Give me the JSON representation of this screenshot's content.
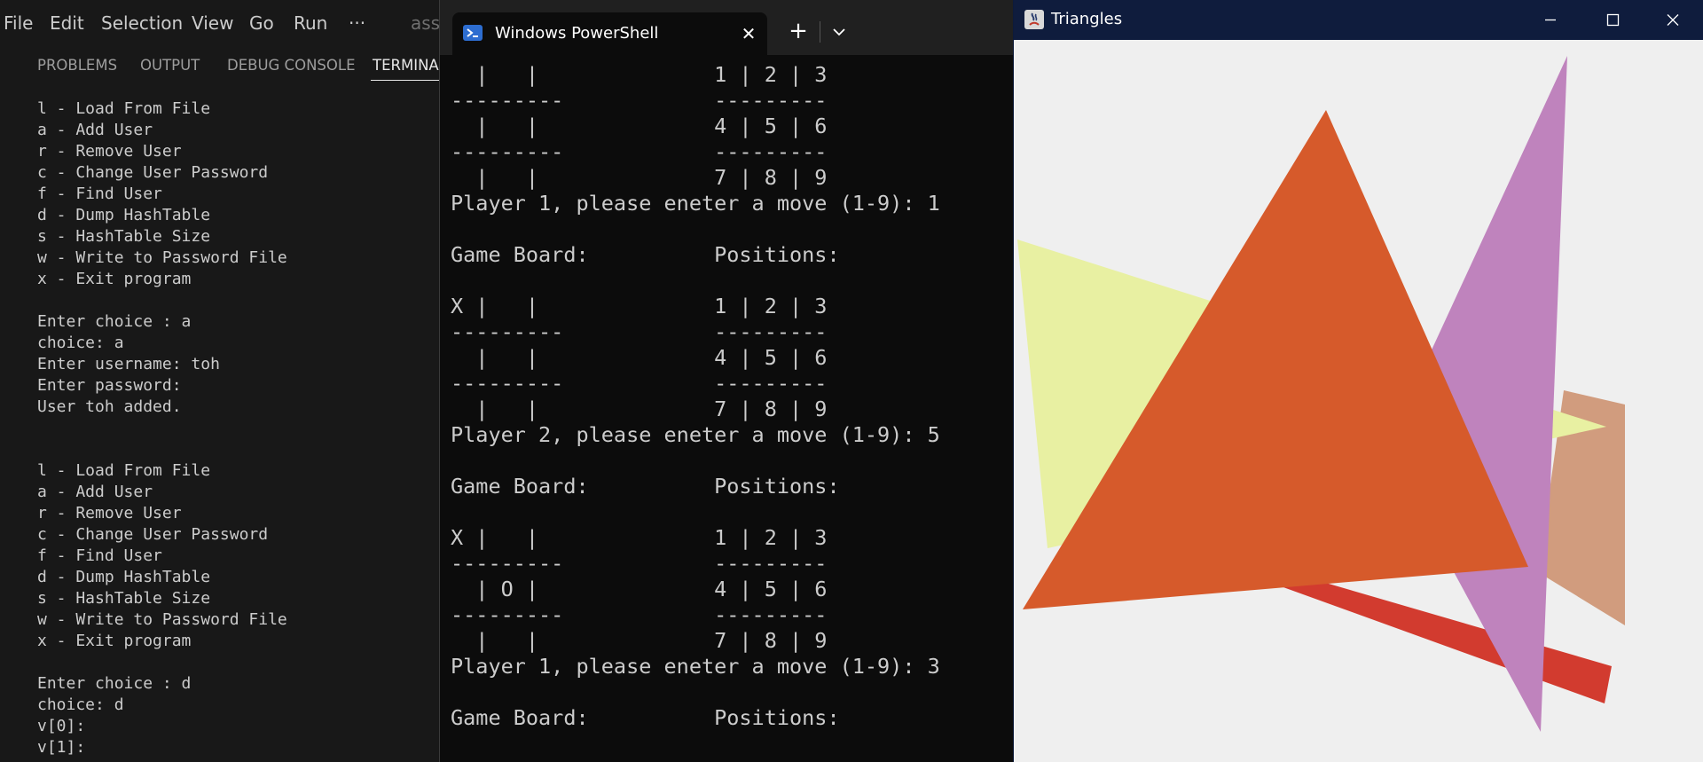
{
  "vscode": {
    "menu": [
      {
        "label": "File",
        "name": "menu-file"
      },
      {
        "label": "Edit",
        "name": "menu-edit"
      },
      {
        "label": "Selection",
        "name": "menu-selection"
      },
      {
        "label": "View",
        "name": "menu-view"
      },
      {
        "label": "Go",
        "name": "menu-go"
      },
      {
        "label": "Run",
        "name": "menu-run"
      },
      {
        "label": "···",
        "name": "menu-more"
      },
      {
        "label": "ass",
        "name": "window-title-fragment"
      }
    ],
    "panel_tabs": [
      {
        "label": "PROBLEMS",
        "name": "tab-problems"
      },
      {
        "label": "OUTPUT",
        "name": "tab-output"
      },
      {
        "label": "DEBUG CONSOLE",
        "name": "tab-debug-console"
      },
      {
        "label": "TERMINAL",
        "name": "tab-terminal"
      }
    ],
    "active_tab": "TERMINAL",
    "terminal_text": "l - Load From File\na - Add User\nr - Remove User\nc - Change User Password\nf - Find User\nd - Dump HashTable\ns - HashTable Size\nw - Write to Password File\nx - Exit program\n\nEnter choice : a\nchoice: a\nEnter username: toh\nEnter password:\nUser toh added.\n\n\nl - Load From File\na - Add User\nr - Remove User\nc - Change User Password\nf - Find User\nd - Dump HashTable\ns - HashTable Size\nw - Write to Password File\nx - Exit program\n\nEnter choice : d\nchoice: d\nv[0]:\nv[1]:"
  },
  "powershell": {
    "tab_title": "Windows PowerShell",
    "close_glyph": "✕",
    "new_tab_glyph": "+",
    "console_text": "  |   |              1 | 2 | 3\n---------            ---------\n  |   |              4 | 5 | 6\n---------            ---------\n  |   |              7 | 8 | 9\nPlayer 1, please eneter a move (1-9): 1\n\nGame Board:          Positions:\n\nX |   |              1 | 2 | 3\n---------            ---------\n  |   |              4 | 5 | 6\n---------            ---------\n  |   |              7 | 8 | 9\nPlayer 2, please eneter a move (1-9): 5\n\nGame Board:          Positions:\n\nX |   |              1 | 2 | 3\n---------            ---------\n  | O |              4 | 5 | 6\n---------            ---------\n  |   |              7 | 8 | 9\nPlayer 1, please eneter a move (1-9): 3\n\nGame Board:          Positions:"
  },
  "triangles": {
    "title": "Triangles",
    "colors": {
      "background": "#efefef",
      "yellow": "#e8f0a2",
      "tan": "#d19c7e",
      "red": "#d23b2f",
      "purple": "#bf83bd",
      "orange": "#d65a2b",
      "titlebar": "#0f1c3d"
    },
    "controls": [
      "minimize-icon",
      "maximize-icon",
      "close-icon"
    ]
  }
}
